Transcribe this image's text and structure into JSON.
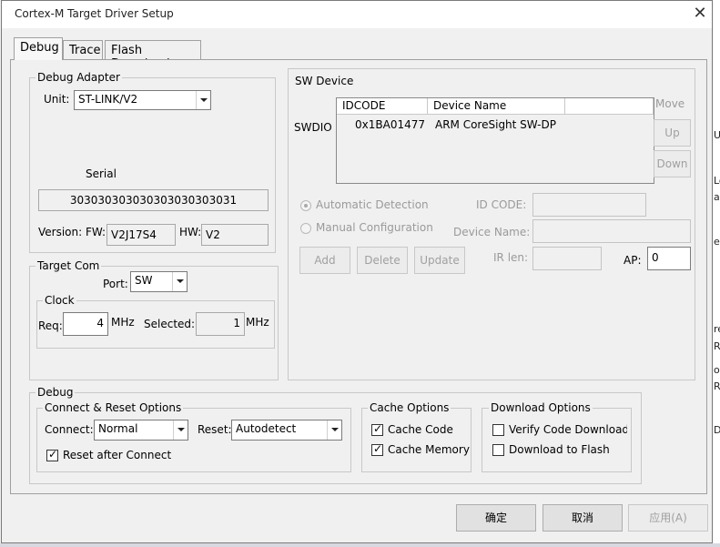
{
  "window": {
    "title": "Cortex-M Target Driver Setup"
  },
  "tabs": [
    {
      "label": "Debug"
    },
    {
      "label": "Trace"
    },
    {
      "label": "Flash Download"
    }
  ],
  "debug_adapter": {
    "group_label": "Debug Adapter",
    "unit_label": "Unit:",
    "unit_value": "ST-LINK/V2",
    "serial_label": "Serial",
    "serial_value": "303030303030303030303031",
    "version_label": "Version: FW:",
    "fw_value": "V2J17S4",
    "hw_label": "HW:",
    "hw_value": "V2"
  },
  "sw_device": {
    "group_label": "SW Device",
    "swdio_label": "SWDIO",
    "columns": [
      "IDCODE",
      "Device Name"
    ],
    "rows": [
      {
        "idcode": "0x1BA01477",
        "device_name": "ARM CoreSight SW-DP"
      }
    ],
    "move_label": "Move",
    "up_label": "Up",
    "down_label": "Down",
    "auto_detect_label": "Automatic Detection",
    "manual_config_label": "Manual Configuration",
    "id_code_label": "ID CODE:",
    "device_name_label": "Device Name:",
    "add_label": "Add",
    "delete_label": "Delete",
    "update_label": "Update",
    "ir_len_label": "IR len:",
    "ap_label": "AP:",
    "ap_value": "0"
  },
  "target_com": {
    "group_label": "Target Com",
    "port_label": "Port:",
    "port_value": "SW",
    "clock_label": "Clock",
    "req_label": "Req:",
    "req_value": "4",
    "req_unit": "MHz",
    "selected_label": "Selected:",
    "selected_value": "1",
    "selected_unit": "MHz"
  },
  "debug_section": {
    "group_label": "Debug",
    "connect_reset": {
      "group_label": "Connect & Reset Options",
      "connect_label": "Connect:",
      "connect_value": "Normal",
      "reset_label": "Reset:",
      "reset_value": "Autodetect",
      "reset_after_connect_label": "Reset after Connect",
      "reset_after_connect_checked": true
    },
    "cache_options": {
      "group_label": "Cache Options",
      "cache_code_label": "Cache Code",
      "cache_code_checked": true,
      "cache_memory_label": "Cache Memory",
      "cache_memory_checked": true
    },
    "download_options": {
      "group_label": "Download Options",
      "verify_label": "Verify Code Download",
      "verify_checked": false,
      "download_flash_label": "Download to Flash",
      "download_flash_checked": false
    }
  },
  "footer": {
    "ok_label": "确定",
    "cancel_label": "取消",
    "apply_label": "应用(A)"
  },
  "background_peek": [
    "Us",
    "Lo",
    "ali",
    "es",
    "re",
    "R",
    "og",
    "R",
    "De"
  ]
}
